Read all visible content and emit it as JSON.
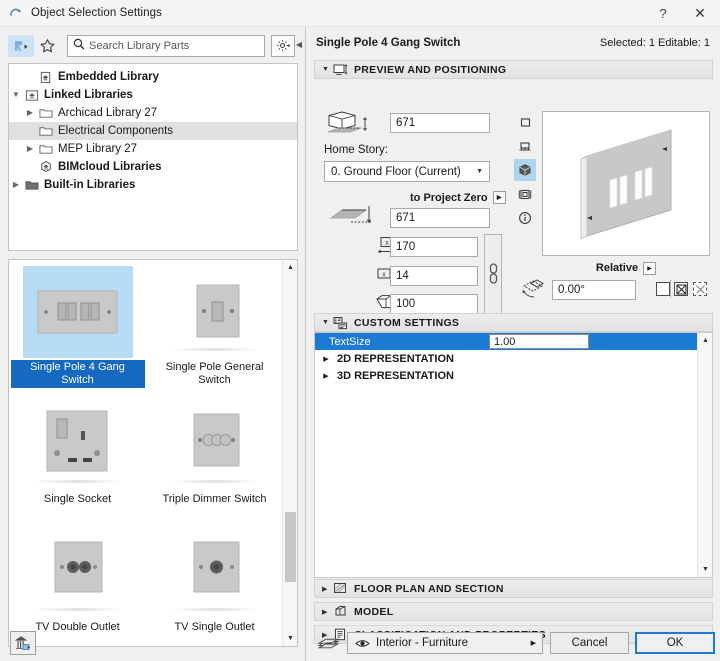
{
  "window": {
    "title": "Object Selection Settings",
    "icon": "archicad-object-icon",
    "help_label": "?",
    "close_label": "✕"
  },
  "library_browser": {
    "favorites_icon": "library-part-icon",
    "star_icon": "star-icon",
    "search": {
      "placeholder": "Search Library Parts",
      "value": ""
    },
    "settings_icon": "gear-icon",
    "collapse_icon": "collapse-left-icon",
    "tree": [
      {
        "label": "Embedded Library",
        "icon": "embedded-library-icon",
        "indent": 1,
        "twisty": "none",
        "bold": true,
        "selected": false
      },
      {
        "label": "Linked Libraries",
        "icon": "linked-library-icon",
        "indent": 0,
        "twisty": "open",
        "bold": true,
        "selected": false
      },
      {
        "label": "Archicad Library 27",
        "icon": "folder-icon",
        "indent": 1,
        "twisty": "closed",
        "bold": false,
        "selected": false
      },
      {
        "label": "Electrical Components",
        "icon": "folder-icon",
        "indent": 1,
        "twisty": "none",
        "bold": false,
        "selected": true
      },
      {
        "label": "MEP Library 27",
        "icon": "folder-icon",
        "indent": 1,
        "twisty": "closed",
        "bold": false,
        "selected": false
      },
      {
        "label": "BIMcloud Libraries",
        "icon": "bimcloud-icon",
        "indent": 1,
        "twisty": "none",
        "bold": true,
        "selected": false
      },
      {
        "label": "Built-in Libraries",
        "icon": "folder-dark-icon",
        "indent": 0,
        "twisty": "closed",
        "bold": true,
        "selected": false
      }
    ],
    "thumbnails": [
      {
        "label": "Single Pole 4 Gang Switch",
        "type": "gang4",
        "selected": true
      },
      {
        "label": "Single Pole General Switch",
        "type": "general",
        "selected": false
      },
      {
        "label": "Single Socket",
        "type": "socket",
        "selected": false
      },
      {
        "label": "Triple Dimmer Switch",
        "type": "dimmer",
        "selected": false
      },
      {
        "label": "TV Double Outlet",
        "type": "tvdouble",
        "selected": false
      },
      {
        "label": "TV Single Outlet",
        "type": "tvsingle",
        "selected": false
      }
    ],
    "library_manager_icon": "library-manager-icon"
  },
  "settings": {
    "object_name": "Single Pole 4 Gang Switch",
    "selection_info": "Selected: 1 Editable: 1",
    "sections": {
      "preview": {
        "label": "PREVIEW AND POSITIONING",
        "icon": "preview-positioning-icon",
        "expanded": true
      },
      "custom": {
        "label": "CUSTOM SETTINGS",
        "icon": "custom-settings-icon",
        "expanded": true
      },
      "floorplan": {
        "label": "FLOOR PLAN AND SECTION",
        "icon": "floor-plan-icon",
        "expanded": false
      },
      "model": {
        "label": "MODEL",
        "icon": "model-cube-icon",
        "expanded": false
      },
      "classification": {
        "label": "CLASSIFICATION AND PROPERTIES",
        "icon": "classification-icon",
        "expanded": false
      }
    },
    "positioning": {
      "elevation_to_home_story": {
        "icon": "elevation-home-story-icon",
        "value": "671"
      },
      "home_story_label": "Home Story:",
      "home_story_value": "0. Ground Floor (Current)",
      "to_project_zero_label": "to Project Zero",
      "elevation_to_project_zero": {
        "icon": "elevation-project-zero-icon",
        "value": "671"
      },
      "x_size": {
        "icon": "x-size-icon",
        "value": "170"
      },
      "y_size": {
        "icon": "y-size-icon",
        "value": "14"
      },
      "z_size": {
        "icon": "z-size-icon",
        "value": "100"
      },
      "link_icon": "chain-link-icon"
    },
    "preview_toolbar": [
      {
        "icon": "2d-symbol-icon",
        "active": false
      },
      {
        "icon": "elevation-view-icon",
        "active": false
      },
      {
        "icon": "3d-view-icon",
        "active": true
      },
      {
        "icon": "section-view-icon",
        "active": false
      },
      {
        "icon": "info-icon",
        "active": false
      }
    ],
    "rotation": {
      "mode_label": "Relative",
      "mode_arrow_icon": "popup-arrow-icon",
      "angle_icon": "rotation-angle-icon",
      "angle_value": "0.00°",
      "mirror_checkbox": {
        "icon": "empty-checkbox-icon",
        "checked": false
      },
      "hotspot_icon1": "marked-distances-icon",
      "hotspot_icon2": "hotspot-set-icon"
    },
    "custom_params": {
      "rows": [
        {
          "name": "TextSize",
          "value": "1.00",
          "highlighted": true
        }
      ],
      "groups": [
        {
          "label": "2D REPRESENTATION"
        },
        {
          "label": "3D REPRESENTATION"
        }
      ]
    },
    "footer": {
      "layer_icon": "layers-icon",
      "eye_icon": "eye-icon",
      "layer_value": "Interior - Furniture",
      "layer_arrow_icon": "popup-arrow-icon",
      "cancel_label": "Cancel",
      "ok_label": "OK"
    }
  },
  "colors": {
    "accent_blue": "#1a7ad4",
    "selection_blue": "#b8dcf5",
    "panel_gray": "#f0f0f0",
    "section_gray": "#e6e6e6"
  }
}
